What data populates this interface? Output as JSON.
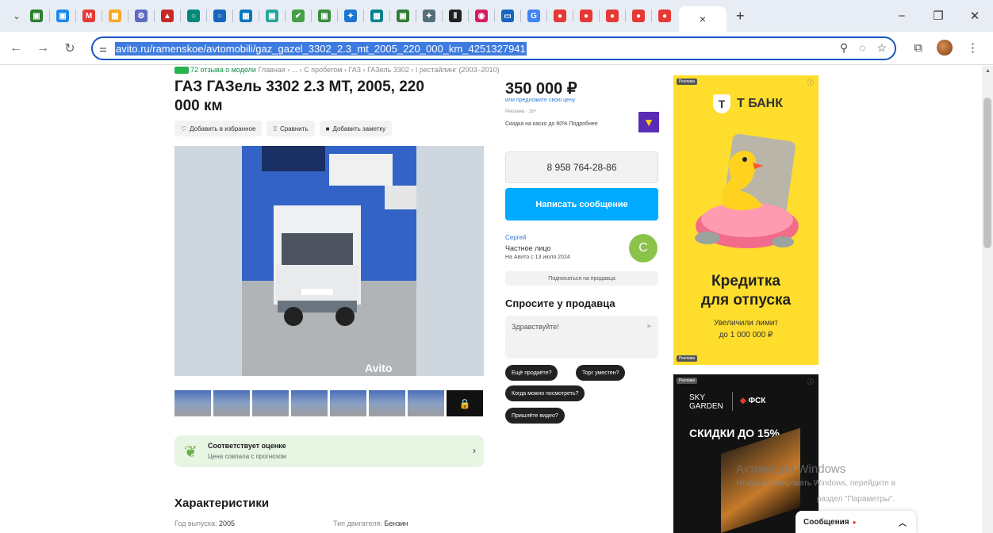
{
  "browser": {
    "tab_list_icon": "chevron-down-icon",
    "active_tab_close": "×",
    "new_tab": "+",
    "window_controls": [
      "−",
      "❐",
      "✕"
    ],
    "favicons": [
      {
        "name": "bookmark-favicon-1",
        "color": "#2e7d32",
        "glyph": "▣"
      },
      {
        "name": "bookmark-favicon-2",
        "color": "#1e88e5",
        "glyph": "▣"
      },
      {
        "name": "bookmark-favicon-3",
        "color": "#e53935",
        "glyph": "M"
      },
      {
        "name": "bookmark-favicon-4",
        "color": "#f9a825",
        "glyph": "▦"
      },
      {
        "name": "bookmark-favicon-5",
        "color": "#5c6bc0",
        "glyph": "⚙"
      },
      {
        "name": "bookmark-favicon-6",
        "color": "#c62828",
        "glyph": "▲"
      },
      {
        "name": "bookmark-favicon-7",
        "color": "#00897b",
        "glyph": "○"
      },
      {
        "name": "bookmark-favicon-8",
        "color": "#1565c0",
        "glyph": "○"
      },
      {
        "name": "bookmark-favicon-9",
        "color": "#0277bd",
        "glyph": "▦"
      },
      {
        "name": "bookmark-favicon-10",
        "color": "#26a69a",
        "glyph": "▣"
      },
      {
        "name": "bookmark-favicon-11",
        "color": "#43a047",
        "glyph": "✔"
      },
      {
        "name": "bookmark-favicon-12",
        "color": "#388e3c",
        "glyph": "▣"
      },
      {
        "name": "bookmark-favicon-13",
        "color": "#1976d2",
        "glyph": "✦"
      },
      {
        "name": "bookmark-favicon-14",
        "color": "#00838f",
        "glyph": "▦"
      },
      {
        "name": "bookmark-favicon-15",
        "color": "#2e7d32",
        "glyph": "▣"
      },
      {
        "name": "bookmark-favicon-16",
        "color": "#546e7a",
        "glyph": "✦"
      },
      {
        "name": "bookmark-favicon-17",
        "color": "#212121",
        "glyph": "Ⅱ"
      },
      {
        "name": "bookmark-favicon-18",
        "color": "#d81b60",
        "glyph": "◉"
      },
      {
        "name": "bookmark-favicon-19",
        "color": "#1565c0",
        "glyph": "▭"
      },
      {
        "name": "bookmark-favicon-20",
        "color": "#4285f4",
        "glyph": "G"
      },
      {
        "name": "bookmark-favicon-21",
        "color": "#e53935",
        "glyph": "●"
      },
      {
        "name": "bookmark-favicon-22",
        "color": "#e53935",
        "glyph": "●"
      },
      {
        "name": "bookmark-favicon-23",
        "color": "#e53935",
        "glyph": "●"
      },
      {
        "name": "bookmark-favicon-24",
        "color": "#e53935",
        "glyph": "●"
      },
      {
        "name": "bookmark-favicon-25",
        "color": "#e53935",
        "glyph": "●"
      }
    ],
    "url": "avito.ru/ramenskoe/avtomobili/gaz_gazel_3302_2.3_mt_2005_220_000_km_4251327941",
    "toolbar_icons": [
      "search-icon",
      "eye-off-icon",
      "star-icon",
      "extensions-icon",
      "profile-avatar",
      "menu-icon"
    ]
  },
  "listing": {
    "breadcrumb_reviews": "72 отзыва о модели",
    "breadcrumb_path": "Главная › ... › С пробегом › ГАЗ › ГАЗель 3302 › I рестайлинг (2003–2010)",
    "title": "ГАЗ ГАЗель 3302 2.3 MT, 2005, 220 000 км",
    "actions": {
      "favorite": "Добавить в избранное",
      "compare": "Сравнить",
      "note": "Добавить заметку"
    },
    "photo_watermark": "Avito",
    "thumbnail_count": 8,
    "estimate": {
      "title": "Соответствует оценке",
      "subtitle": "Цена совпала с прогнозом"
    },
    "characteristics": {
      "heading": "Характеристики",
      "year_label": "Год выпуска:",
      "year_value": "2005",
      "engine_label": "Тип двигателя:",
      "engine_value": "Бензин"
    }
  },
  "sidebar": {
    "price": "350 000 ₽",
    "price_link": "или предложите свою цену",
    "ad_note": "Реклама · 16+",
    "casco": "Скидка на каско до 60% Подробнее",
    "phone": "8 958 764-28-86",
    "message_button": "Написать сообщение",
    "seller": {
      "name": "Сергей",
      "type": "Частное лицо",
      "since": "На Авито с 13 июля 2024",
      "initial": "С"
    },
    "subscribe": "Подписаться на продавца",
    "ask": {
      "title": "Спросите у продавца",
      "placeholder": "Здравствуйте!",
      "chips": [
        "Ещё продаёте?",
        "Торг уместен?",
        "Когда можно посмотреть?",
        "Пришлёте видео?"
      ]
    }
  },
  "ads": {
    "badge": "Реклама",
    "tbank": {
      "brand": "Т БАНК",
      "headline_1": "Кредитка",
      "headline_2": "для отпуска",
      "sub_1": "Увеличили лимит",
      "sub_2": "до 1 000 000 ₽",
      "color": "#ffdd2d"
    },
    "sky": {
      "brand_1": "SKY",
      "brand_2": "GARDEN",
      "fsk": "ФСК",
      "headline": "СКИДКИ ДО 15%"
    }
  },
  "os": {
    "activation_title": "Активация Windows",
    "activation_line_1": "Чтобы активировать Windows, перейдите в",
    "activation_line_2": "раздел \"Параметры\".",
    "messages_label": "Сообщения"
  }
}
